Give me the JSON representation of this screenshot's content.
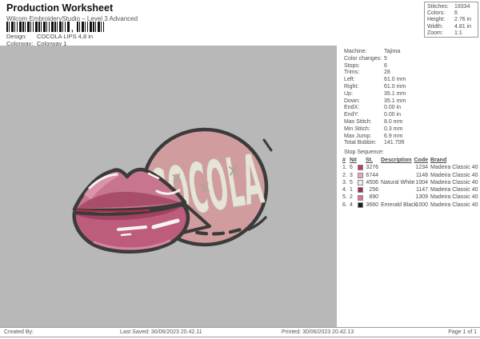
{
  "header": {
    "title": "Production Worksheet",
    "subtitle": "Wilcom EmbroideryStudio – Level 3 Advanced",
    "design_label": "Design:",
    "design_value": "COCOLA LIPS 4,8 in",
    "colorway_label": "Colorway:",
    "colorway_value": "Colorway 1"
  },
  "summary_box": {
    "rows": [
      {
        "label": "Stitches:",
        "value": "19334"
      },
      {
        "label": "Colors:",
        "value": "6"
      },
      {
        "label": "Height:",
        "value": "2.76 in"
      },
      {
        "label": "Width:",
        "value": "4.81 in"
      },
      {
        "label": "Zoom:",
        "value": "1:1"
      }
    ]
  },
  "machine_info": {
    "rows": [
      {
        "label": "Machine:",
        "value": "Tajima"
      },
      {
        "label": "Color changes:",
        "value": "5"
      },
      {
        "label": "Stops:",
        "value": "6"
      },
      {
        "label": "Trims:",
        "value": "28"
      },
      {
        "label": "Left:",
        "value": "61.0 mm"
      },
      {
        "label": "Right:",
        "value": "61.0 mm"
      },
      {
        "label": "Up:",
        "value": "35.1 mm"
      },
      {
        "label": "Down:",
        "value": "35.1 mm"
      },
      {
        "label": "EndX:",
        "value": "0.00 in"
      },
      {
        "label": "EndY:",
        "value": "0.00 in"
      },
      {
        "label": "Max Stitch:",
        "value": "8.0 mm"
      },
      {
        "label": "Min Stitch:",
        "value": "0.3 mm"
      },
      {
        "label": "Max Jump:",
        "value": "6.9 mm"
      },
      {
        "label": "Total Bobbin:",
        "value": "141.70ft"
      }
    ]
  },
  "stop_sequence": {
    "title": "Stop Sequence:",
    "head": {
      "num": "#",
      "n": "N#",
      "st": "St.",
      "description": "Description",
      "code": "Code",
      "brand": "Brand"
    },
    "rows": [
      {
        "num": "1.",
        "n": "6",
        "swatch": "#c23a5c",
        "st": "3276",
        "description": "",
        "code": "1234",
        "brand": "Madeira Classic 40"
      },
      {
        "num": "2.",
        "n": "3",
        "swatch": "#e9a9b7",
        "st": "6744",
        "description": "",
        "code": "1148",
        "brand": "Madeira Classic 40"
      },
      {
        "num": "3.",
        "n": "5",
        "swatch": "#f1ece3",
        "st": "4506",
        "description": "Natural White",
        "code": "1004",
        "brand": "Madeira Classic 40"
      },
      {
        "num": "4.",
        "n": "1",
        "swatch": "#a02c4d",
        "st": "256",
        "description": "",
        "code": "1147",
        "brand": "Madeira Classic 40"
      },
      {
        "num": "5.",
        "n": "2",
        "swatch": "#e2709e",
        "st": "890",
        "description": "",
        "code": "1309",
        "brand": "Madeira Classic 40"
      },
      {
        "num": "6.",
        "n": "4",
        "swatch": "#1c1c1c",
        "st": "3660",
        "description": "Emerald Black",
        "code": "1000",
        "brand": "Madeira Classic 40"
      }
    ]
  },
  "design_art": {
    "bubble_text": "COCOLA",
    "colors": {
      "canvas_gray": "#b8b8b8",
      "bubble_fill": "#d09c9d",
      "outline": "#3b3b3b",
      "text_fill": "#e6e3d7",
      "upper_lip": "#c7768e",
      "upper_lip_dark": "#a84e6b",
      "upper_lip_light": "#dc93a9",
      "lower_lip": "#bd5d7b",
      "lower_lip_dark": "#a24263",
      "highlight": "#f6f4f2",
      "mouth_red": "#b72c45"
    }
  },
  "footer": {
    "created_by": "Created By:",
    "last_saved": "Last Saved: 30/06/2023 20.42.11",
    "printed": "Printed: 30/06/2023 20.42.13",
    "page": "Page 1 of 1"
  }
}
